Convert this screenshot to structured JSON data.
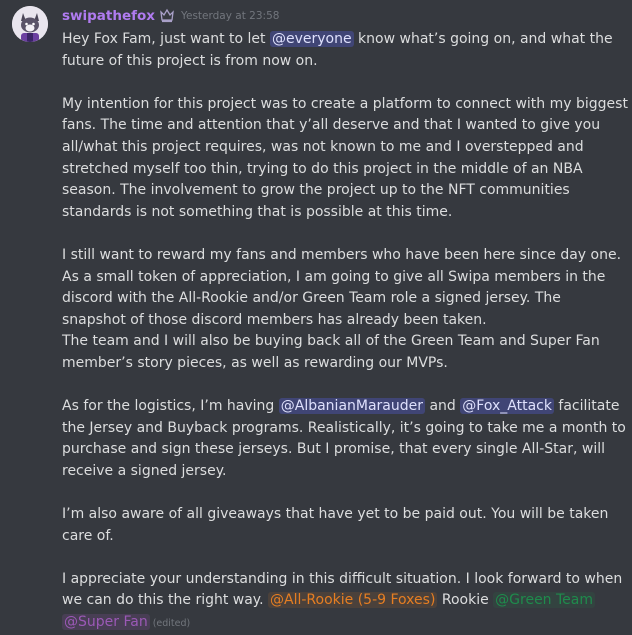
{
  "message": {
    "username": "swipathefox",
    "timestamp": "Yesterday at 23:58",
    "edited_label": "(edited)",
    "avatar_icon": "fox-avatar-icon",
    "badge_icon": "sacramento-kings-badge-icon",
    "lines": {
      "l1a": "Hey Fox Fam, just want to let ",
      "m_everyone": "@everyone",
      "l1b": " know what’s going on, and what the",
      "l2": "future of this project is from now on.",
      "l3": "My intention for this project was to create a platform to connect with my biggest",
      "l4": "fans. The time and attention that y’all deserve and that I wanted to give you",
      "l5": "all/what this project requires, was not known to me and I overstepped and",
      "l6": "stretched myself too thin, trying to do this project in the middle of an NBA",
      "l7": "season. The involvement to grow the project up to the NFT communities",
      "l8": "standards is not something that is possible at this time.",
      "l9": "I still want to reward my fans and members who have been here since day one.",
      "l10": "As a small token of appreciation, I am going to give all Swipa members in the",
      "l11": "discord with the All-Rookie and/or Green Team role a signed jersey. The",
      "l12": "snapshot of those discord members has already been taken.",
      "l13": "The team and I will also be buying back all of the Green Team and Super Fan",
      "l14": "member’s story pieces, as well as rewarding our MVPs.",
      "l15a": "As for the logistics, I’m having ",
      "m_albanian": "@AlbanianMarauder",
      "l15b": " and ",
      "m_fox": "@Fox_Attack",
      "l15c": " facilitate",
      "l16": "the Jersey and Buyback programs. Realistically, it’s going to take me a month to",
      "l17": "purchase and sign these jerseys. But I promise, that every single All-Star, will",
      "l18": "receive a signed jersey.",
      "l19": "I’m also aware of all giveaways that have yet to be paid out. You will be taken",
      "l20": "care of.",
      "l21": "I appreciate your understanding in this difficult situation. I look forward to when",
      "l22a": "we can do this the right way. ",
      "r_allrookie": "@All-Rookie (5-9 Foxes)",
      "l22b": " Rookie ",
      "r_green": "@Green Team",
      "r_superfan": "@Super Fan"
    },
    "colors": {
      "username": "#b07bf0",
      "mention": "#5865f2",
      "role_all_rookie": "#e67e22",
      "role_green_team": "#1f8b4c",
      "role_super_fan": "#9b59b6"
    }
  }
}
